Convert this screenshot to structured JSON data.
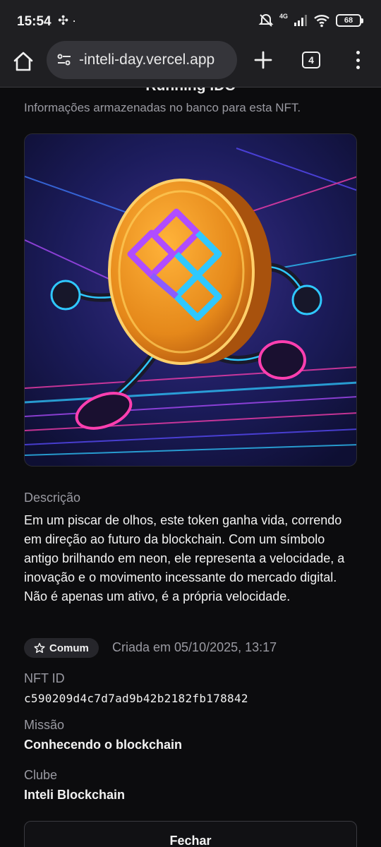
{
  "status_bar": {
    "time": "15:54",
    "battery": "68",
    "network": "4G"
  },
  "browser": {
    "url": "-inteli-day.vercel.app",
    "tab_count": "4"
  },
  "dialog": {
    "title": "Running IDC",
    "subtitle": "Informações armazenadas no banco para esta NFT.",
    "description_label": "Descrição",
    "description": "Em um piscar de olhos, este token ganha vida, correndo em direção ao futuro da blockchain. Com um símbolo antigo brilhando em neon, ele representa a velocidade, a inovação e o movimento incessante do mercado digital. Não é apenas um ativo, é a própria velocidade.",
    "rarity_badge": "Comum",
    "created": "Criada em 05/10/2025, 13:17",
    "nft_id_label": "NFT ID",
    "nft_id": "c590209d4c7d7ad9b42b2182fb178842",
    "mission_label": "Missão",
    "mission": "Conhecendo o blockchain",
    "club_label": "Clube",
    "club": "Inteli Blockchain",
    "close_label": "Fechar"
  },
  "icons": {
    "status_extra": "pinwheel-icon",
    "home": "home-icon",
    "site_settings": "tune-icon",
    "new_tab": "plus-icon",
    "more": "more-vert-icon",
    "rarity": "star-outline-icon"
  },
  "colors": {
    "background": "#0c0c0e",
    "toolbar": "#1f1f22",
    "muted_text": "#9a9aa2",
    "coin_orange": "#f2a01c",
    "neon_purple": "#b04cff",
    "neon_cyan": "#2fc8ff"
  }
}
